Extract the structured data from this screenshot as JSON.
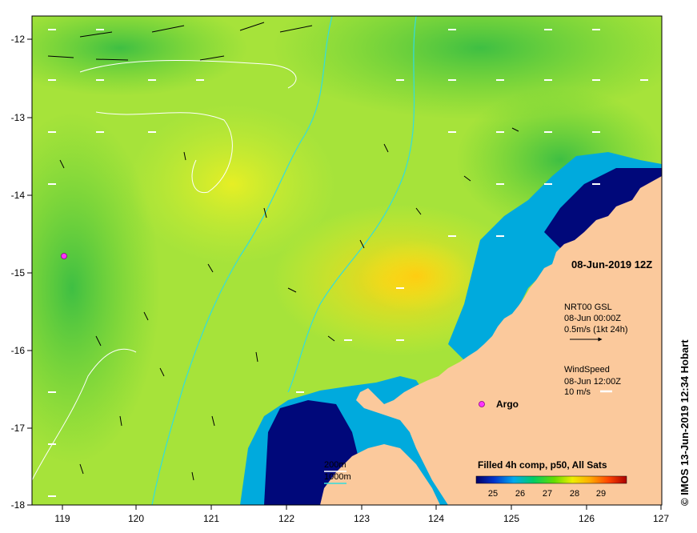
{
  "map": {
    "date_label": "08-Jun-2019 12Z",
    "copyright": "© IMOS 13-Jun-2019 12:34 Hobart",
    "lon_ticks": [
      "119",
      "120",
      "121",
      "122",
      "123",
      "124",
      "125",
      "126",
      "127"
    ],
    "lat_ticks": [
      "-12",
      "-13",
      "-14",
      "-15",
      "-16",
      "-17",
      "-18"
    ],
    "current_legend": {
      "title": "NRT00 GSL",
      "time": "08-Jun 00:00Z",
      "scale": "0.5m/s (1kt 24h)"
    },
    "wind_legend": {
      "title": "WindSpeed",
      "time": "08-Jun 12:00Z",
      "scale": "10 m/s"
    },
    "argo_label": "Argo",
    "isobaths": [
      "200m",
      "1000m"
    ],
    "colorbar": {
      "title": "Filled 4h comp, p50, All Sats",
      "ticks": [
        "25",
        "26",
        "27",
        "28",
        "29"
      ]
    },
    "colors": {
      "land": "#fbc99c",
      "argo": "#ff33ff",
      "isobath_200": "#ffffff",
      "isobath_1000": "#33dddd"
    }
  }
}
